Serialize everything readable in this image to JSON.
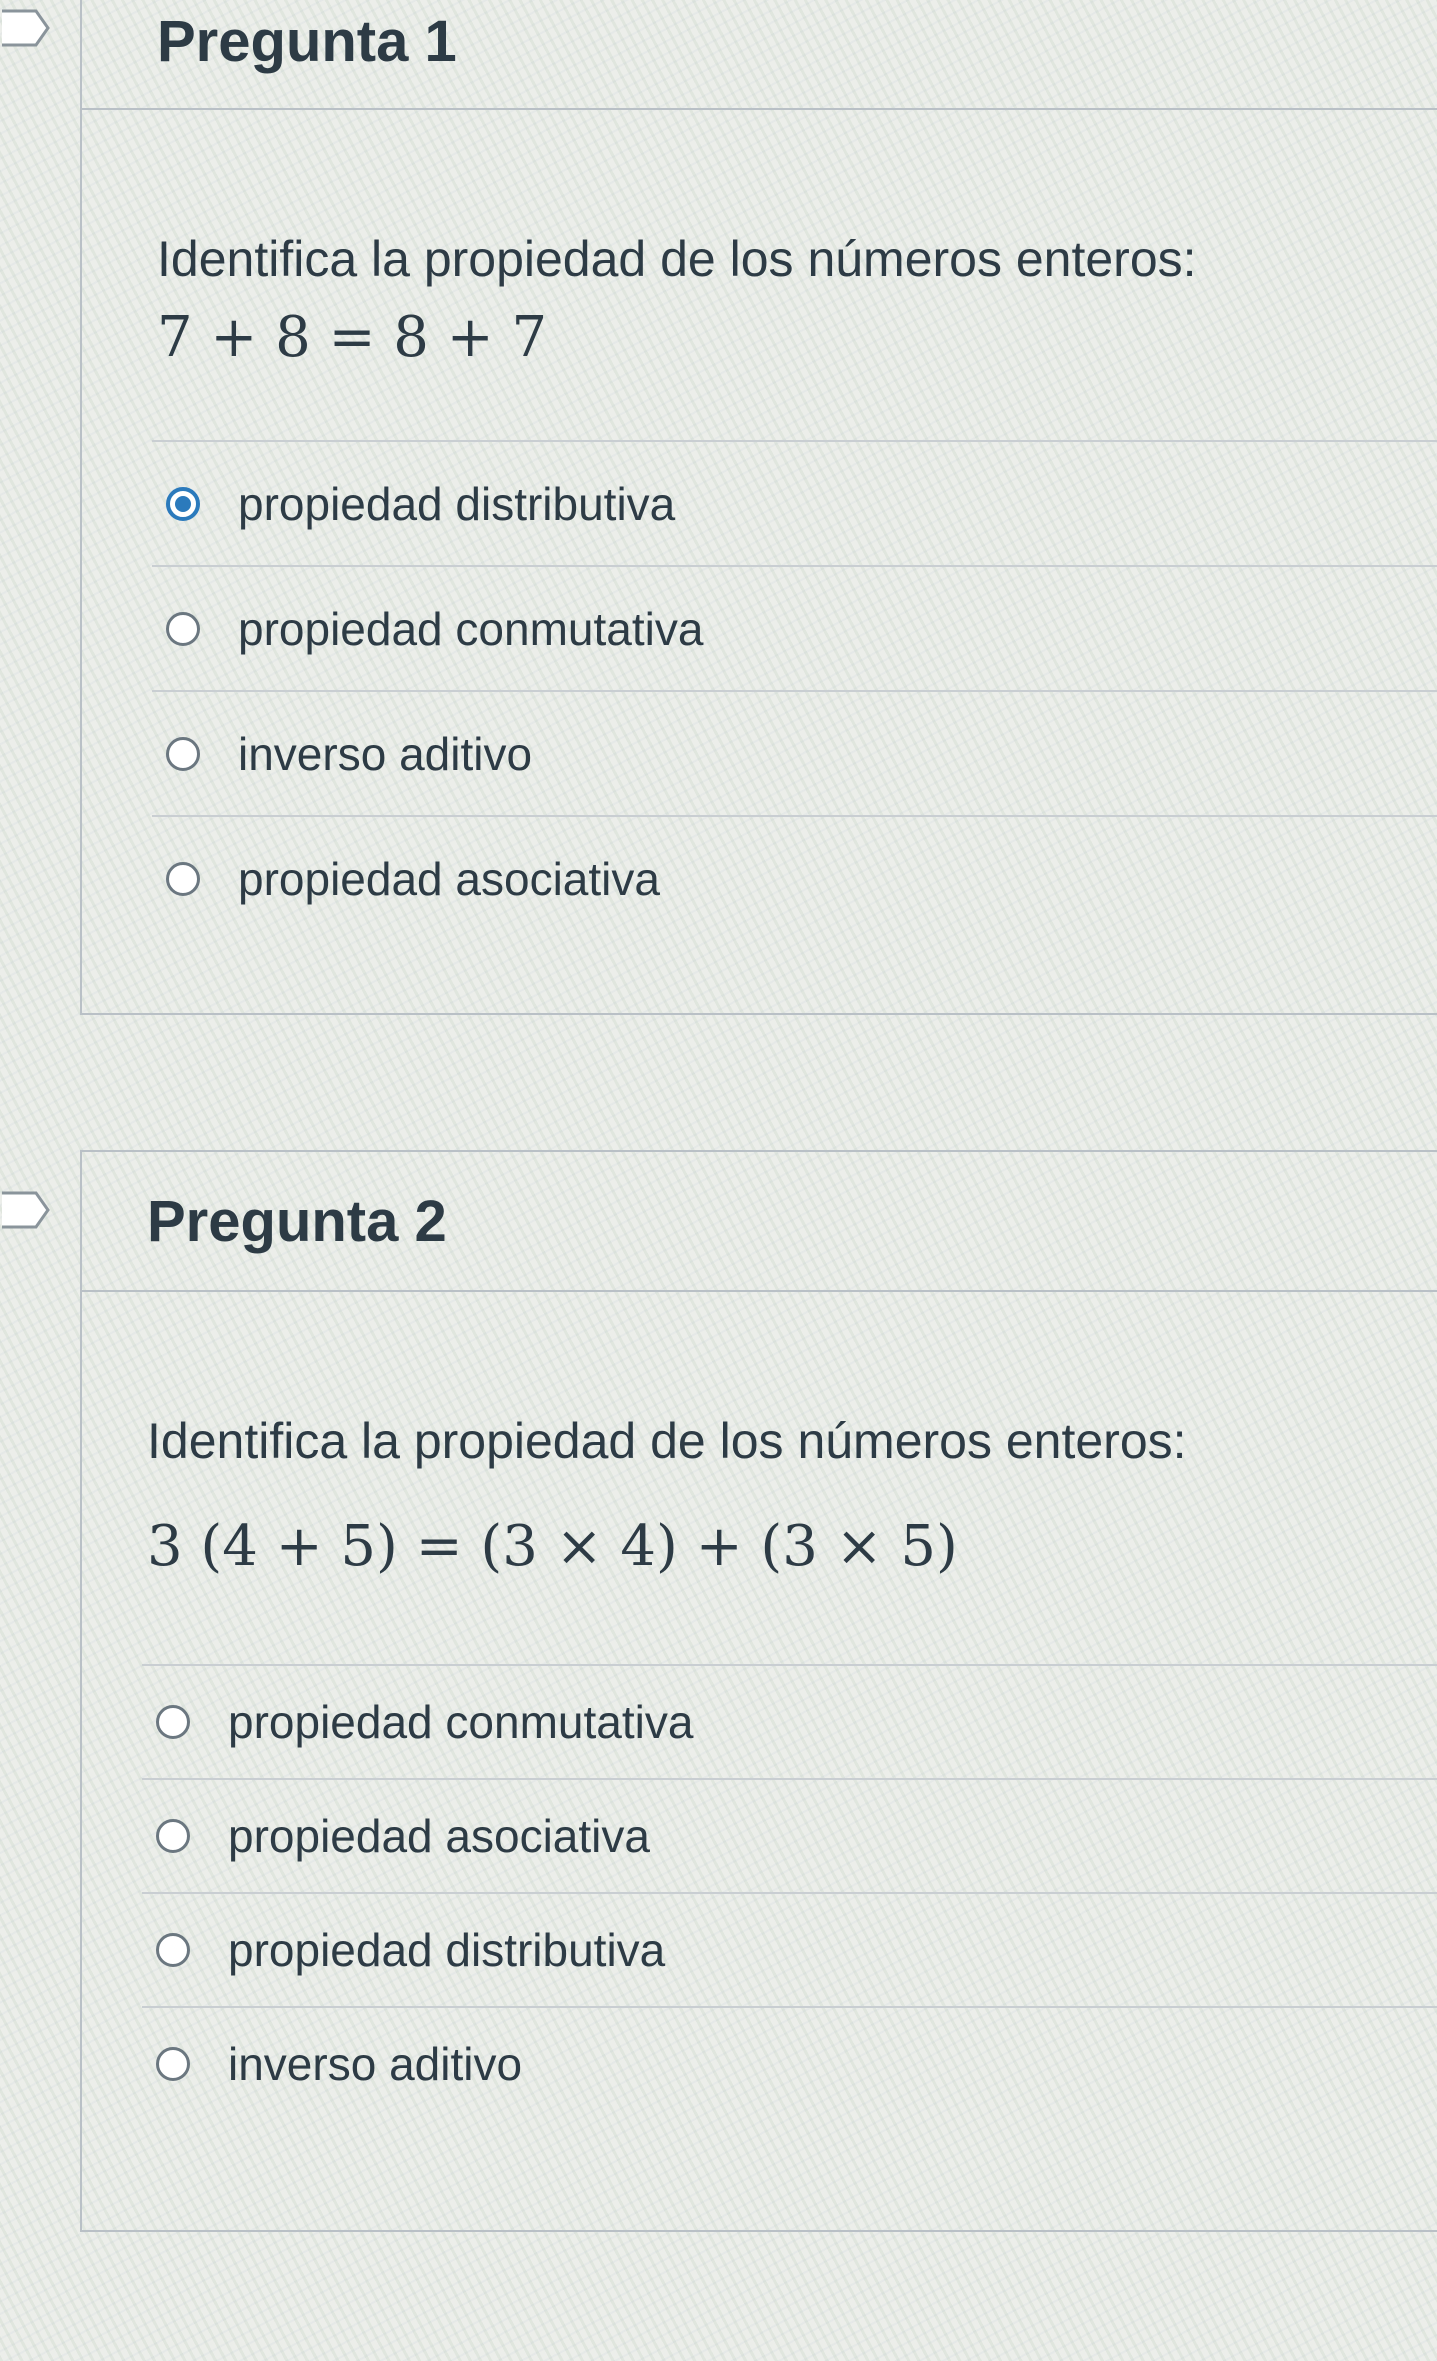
{
  "questions": [
    {
      "title": "Pregunta 1",
      "prompt": "Identifica la propiedad de los números enteros:",
      "math": "7 + 8 = 8 + 7",
      "selected_index": 0,
      "answers": [
        {
          "label": "propiedad distributiva"
        },
        {
          "label": "propiedad conmutativa"
        },
        {
          "label": "inverso aditivo"
        },
        {
          "label": "propiedad asociativa"
        }
      ]
    },
    {
      "title": "Pregunta 2",
      "prompt": "Identifica la propiedad de los números enteros:",
      "math": "3 (4 + 5) = (3 × 4) + (3 × 5)",
      "selected_index": null,
      "answers": [
        {
          "label": "propiedad conmutativa"
        },
        {
          "label": "propiedad asociativa"
        },
        {
          "label": "propiedad distributiva"
        },
        {
          "label": "inverso aditivo"
        }
      ]
    }
  ],
  "colors": {
    "selected_radio": "#2b7abc",
    "text": "#2d3b45",
    "border": "#b9c0c6"
  }
}
